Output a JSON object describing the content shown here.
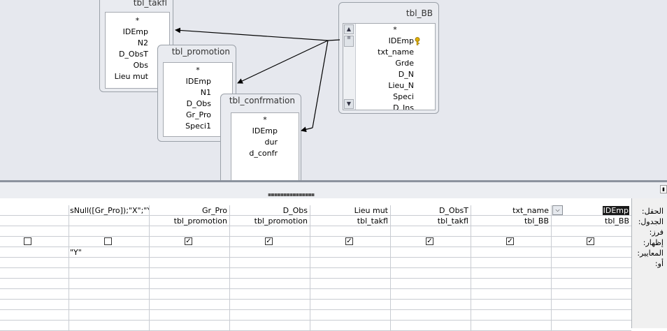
{
  "tables": {
    "tbl_takfl": {
      "title": "tbl_takfl",
      "fields": [
        "*",
        "IDEmp",
        "N2",
        "D_ObsT",
        "Obs",
        "Lieu mut"
      ]
    },
    "tbl_promotion": {
      "title": "tbl_promotion",
      "fields": [
        "*",
        "IDEmp",
        "N1",
        "D_Obs",
        "Gr_Pro",
        "Speci1"
      ]
    },
    "tbl_confrmation": {
      "title": "tbl_confrmation",
      "fields": [
        "*",
        "IDEmp",
        "dur",
        "d_confr"
      ]
    },
    "tbl_BB": {
      "title": "tbl_BB",
      "fields": [
        "*",
        "IDEmp",
        "txt_name",
        "Grde",
        "D_N",
        "Lieu_N",
        "Speci",
        "D_Ins"
      ]
    }
  },
  "icons": {
    "primary_key": "key-icon",
    "scroll_up": "arrow-up-icon",
    "scroll_down": "arrow-down-icon"
  },
  "grid": {
    "row_labels": {
      "field": "الحقل:",
      "table": "الجدول:",
      "sort": "فرز:",
      "show": "إظهار:",
      "criteria": "المعايير:",
      "or": "أو:"
    },
    "columns": [
      {
        "field": "IDEmp",
        "table": "tbl_BB",
        "show": true,
        "criteria": "",
        "selected": true
      },
      {
        "field": "txt_name",
        "table": "tbl_BB",
        "show": true,
        "criteria": ""
      },
      {
        "field": "D_ObsT",
        "table": "tbl_takfl",
        "show": true,
        "criteria": ""
      },
      {
        "field": "Lieu mut",
        "table": "tbl_takfl",
        "show": true,
        "criteria": ""
      },
      {
        "field": "D_Obs",
        "table": "tbl_promotion",
        "show": true,
        "criteria": ""
      },
      {
        "field": "Gr_Pro",
        "table": "tbl_promotion",
        "show": true,
        "criteria": ""
      },
      {
        "field": "sNull([Gr_Pro]);\"X\";\"Y\")",
        "table": "",
        "show": false,
        "criteria": "\"Y\""
      },
      {
        "field": "",
        "table": "",
        "show": false,
        "criteria": ""
      }
    ]
  },
  "colors": {
    "pane_bg": "#e6e8ee",
    "grid_line": "#c9ccd2",
    "link_line": "#000000",
    "selection": "#1a1a1a"
  }
}
